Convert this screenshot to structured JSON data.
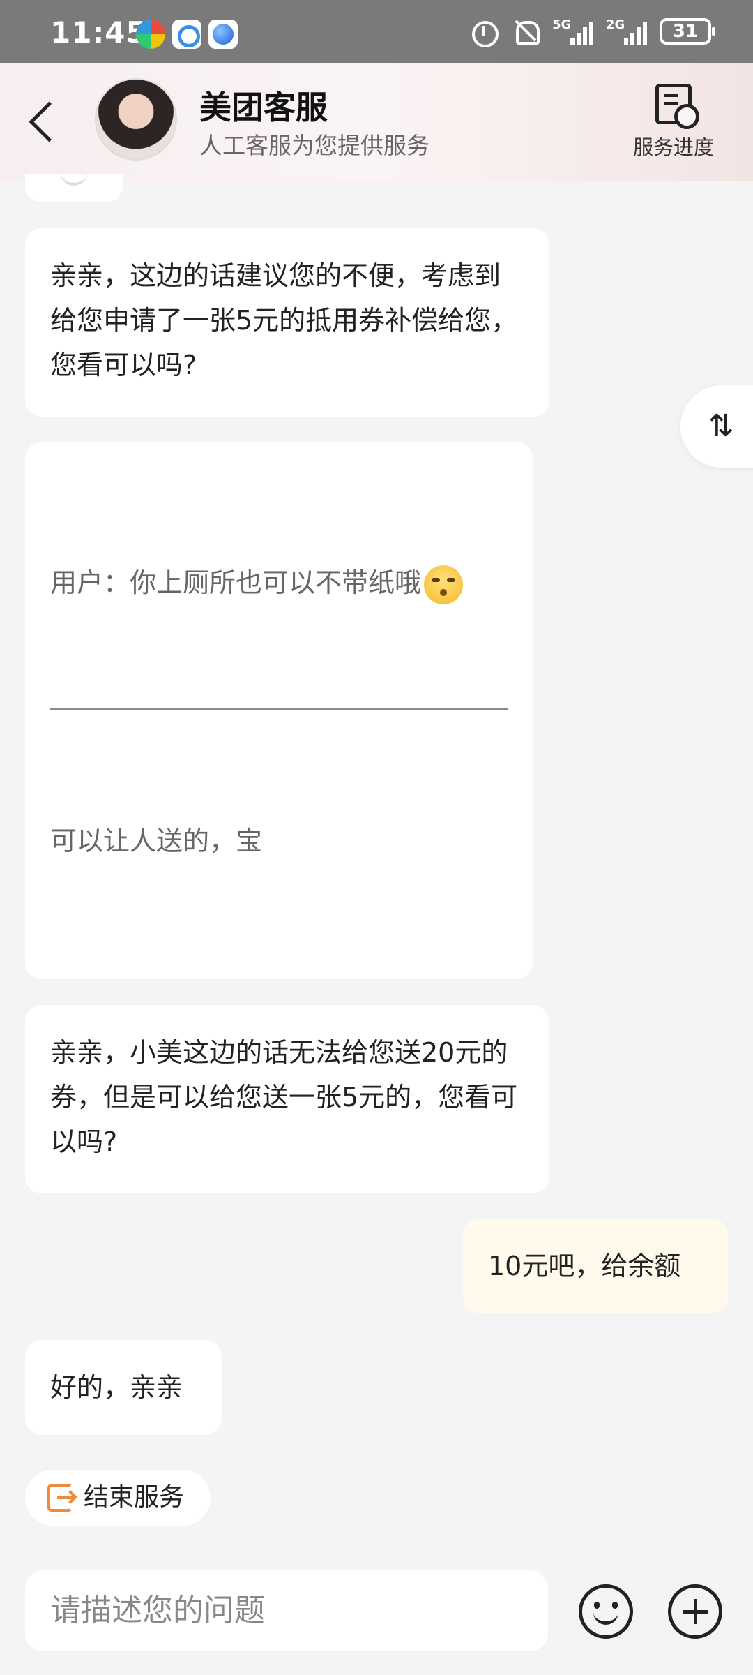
{
  "status_bar": {
    "time": "11:45",
    "signal1_label": "5G",
    "signal2_label": "2G",
    "battery": "31"
  },
  "header": {
    "title": "美团客服",
    "subtitle": "人工客服为您提供服务",
    "progress_label": "服务进度"
  },
  "messages": {
    "m1": "亲亲，这边的话建议您的不便，考虑到给您申请了一张5元的抵用券补偿给您，您看可以吗?",
    "m2_quote": "用户：你上厕所也可以不带纸哦",
    "m2_reply": "可以让人送的，宝",
    "m3": "亲亲，小美这边的话无法给您送20元的券，但是可以给您送一张5元的，您看可以吗?",
    "user1": "10元吧，给余额",
    "m4": "好的，亲亲"
  },
  "end_service_label": "结束服务",
  "scroll_toggle_icon": "⇅",
  "input": {
    "placeholder": "请描述您的问题"
  },
  "icons": {
    "back": "back-arrow-icon",
    "progress": "document-clock-icon",
    "emoji": "smiley-icon",
    "plus": "plus-icon",
    "exit": "exit-icon"
  },
  "colors": {
    "accent_orange": "#f0893a",
    "user_bubble": "#fffaec",
    "background": "#f4f4f4"
  }
}
